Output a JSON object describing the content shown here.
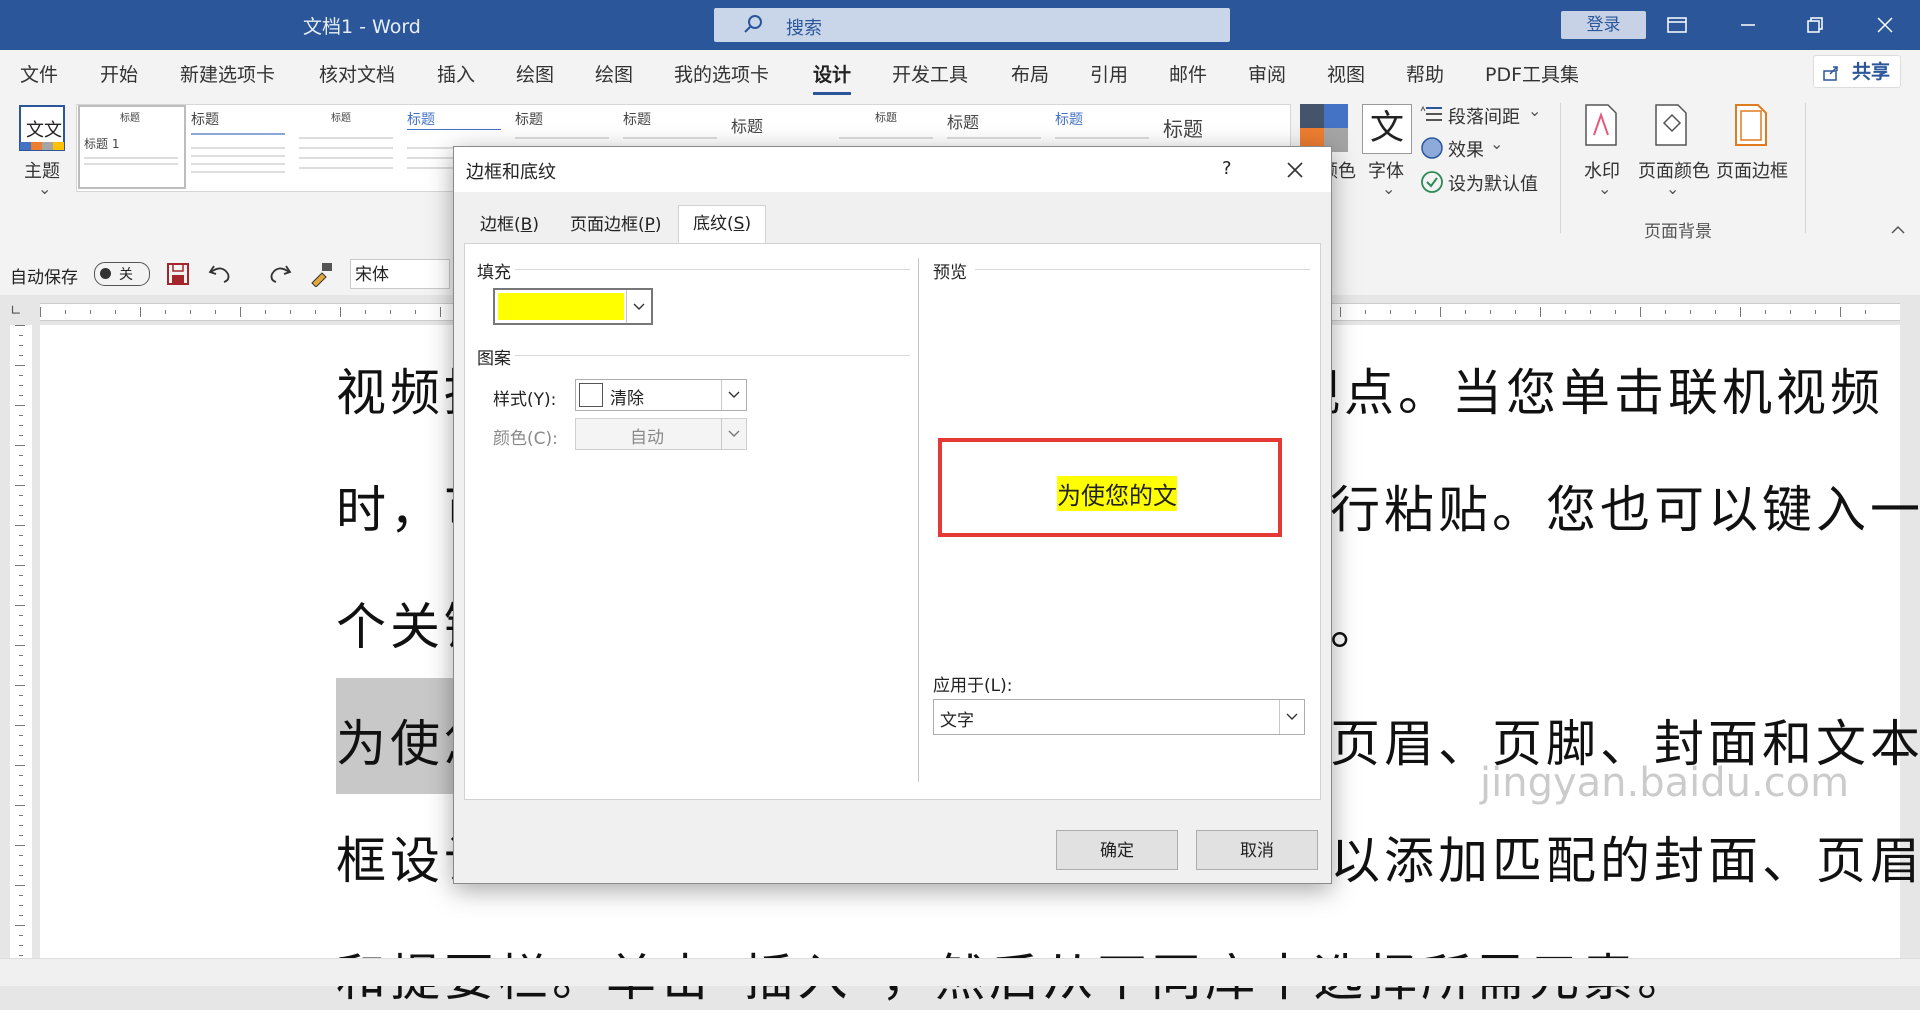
{
  "titlebar": {
    "title": "文档1  -  Word",
    "search_placeholder": "搜索",
    "login_label": "登录",
    "icons": [
      "search-icon",
      "ribbon-display-icon",
      "minimize-icon",
      "restore-icon",
      "close-icon"
    ]
  },
  "menu": {
    "tabs": [
      "文件",
      "开始",
      "新建选项卡",
      "核对文档",
      "插入",
      "绘图",
      "绘图",
      "我的选项卡",
      "设计",
      "开发工具",
      "布局",
      "引用",
      "邮件",
      "审阅",
      "视图",
      "帮助",
      "PDF工具集"
    ],
    "active": "设计",
    "share_label": "共享"
  },
  "ribbon": {
    "theme_label": "主题",
    "theme_icon_text": "文文",
    "gallery_items": [
      "标题",
      "标题",
      "标题",
      "标题",
      "标题",
      "标题",
      "标题",
      "标题",
      "标题",
      "标题",
      "标题",
      "标题"
    ],
    "first_thumb_sub": "标题 1",
    "colors_label": "颜色",
    "fonts_label": "字体",
    "fonts_icon_text": "文",
    "paragraph_spacing": "段落间距",
    "effects": "效果",
    "set_default": "设为默认值",
    "watermark": "水印",
    "page_color": "页面颜色",
    "page_border": "页面边框",
    "page_background_group": "页面背景"
  },
  "qat": {
    "autosave_label": "自动保存",
    "autosave_state": "关",
    "font_name": "宋体"
  },
  "document": {
    "lines": [
      {
        "left": "视频提",
        "right": "观点。当您单击联机视频"
      },
      {
        "left": "时，可",
        "right": "行粘贴。您也可以键入一"
      },
      {
        "left": "个关键",
        "right": "。"
      },
      {
        "left": "为使您",
        "right": "页眉、页脚、封面和文本"
      },
      {
        "left": "框设计",
        "right": "以添加匹配的封面、页眉"
      },
      {
        "left": "和提要栏。单击“插入”，然后从不同库中选择所需元素。",
        "right": ""
      }
    ]
  },
  "dialog": {
    "title": "边框和底纹",
    "help": "?",
    "tabs": [
      {
        "label": "边框(",
        "key": "B",
        "suffix": ")"
      },
      {
        "label": "页面边框(",
        "key": "P",
        "suffix": ")"
      },
      {
        "label": "底纹(",
        "key": "S",
        "suffix": ")"
      }
    ],
    "active_tab": 2,
    "fill_section": "填充",
    "fill_color": "#ffff00",
    "pattern_section": "图案",
    "style_label": "样式(Y):",
    "style_value": "清除",
    "color_label": "颜色(C):",
    "color_value": "自动",
    "preview_section": "预览",
    "preview_text": "为使您的文",
    "preview_border_color": "#e53935",
    "apply_to_label": "应用于(L):",
    "apply_to_value": "文字",
    "ok_label": "确定",
    "cancel_label": "取消"
  },
  "watermark_text": "jingyan.baidu.com"
}
